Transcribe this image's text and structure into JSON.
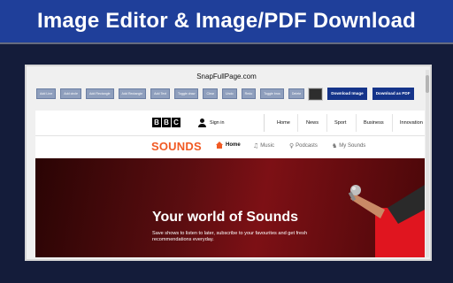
{
  "banner": {
    "title": "Image Editor & Image/PDF Download"
  },
  "editor": {
    "title": "SnapFullPage.com",
    "tools": [
      {
        "label": "Add Line"
      },
      {
        "label": "Add circle"
      },
      {
        "label": "Add Rectangle"
      },
      {
        "label": "Add Rectangle"
      },
      {
        "label": "Add Text"
      },
      {
        "label": "Toggle draw"
      },
      {
        "label": "Clear"
      },
      {
        "label": "Undo"
      },
      {
        "label": "Redo"
      },
      {
        "label": "Toggle brus"
      },
      {
        "label": "Delete"
      }
    ],
    "swatch_color": "#2d2d2d",
    "download_image_label": "Download Image",
    "download_pdf_label": "Download as PDF"
  },
  "page": {
    "bbc_logo": [
      "B",
      "B",
      "C"
    ],
    "signin_label": "Sign in",
    "nav": [
      "Home",
      "News",
      "Sport",
      "Business",
      "Innovation"
    ],
    "sounds_logo": "SOUNDS",
    "sounds_nav": {
      "home": "Home",
      "music": "Music",
      "podcasts": "Podcasts",
      "my_sounds": "My Sounds"
    },
    "accent_color": "#f15a24",
    "hero": {
      "title": "Your world of Sounds",
      "subtitle": "Save shows to listen to later, subscribe to your favourites and get fresh recommendations everyday."
    }
  }
}
